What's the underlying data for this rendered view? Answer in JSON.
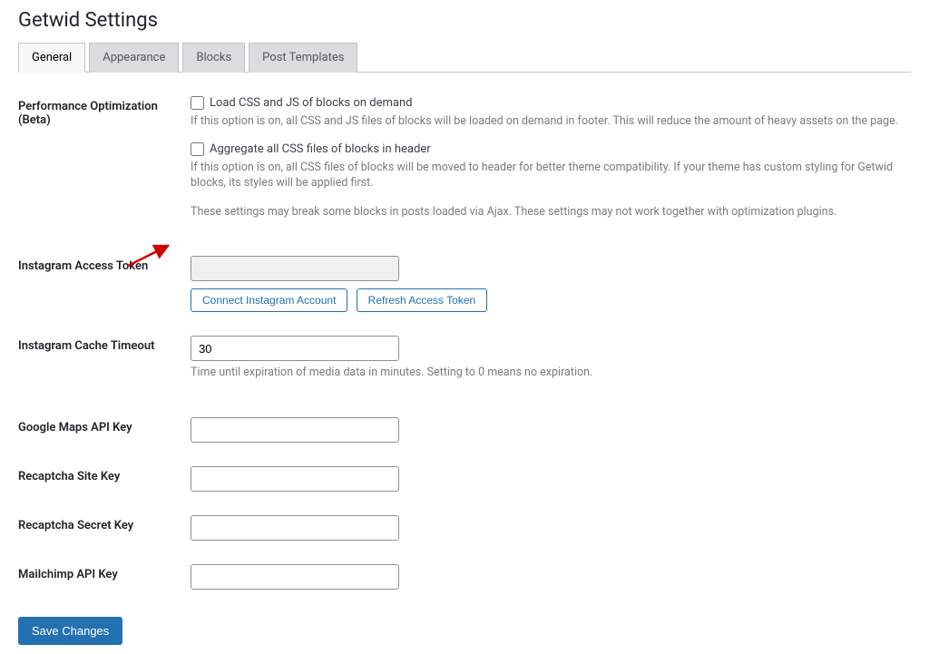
{
  "page_title": "Getwid Settings",
  "tabs": {
    "general": "General",
    "appearance": "Appearance",
    "blocks": "Blocks",
    "post_templates": "Post Templates"
  },
  "perf": {
    "label": "Performance Optimization (Beta)",
    "load_on_demand_label": "Load CSS and JS of blocks on demand",
    "load_on_demand_desc": "If this option is on, all CSS and JS files of blocks will be loaded on demand in footer. This will reduce the amount of heavy assets on the page.",
    "aggregate_label": "Aggregate all CSS files of blocks in header",
    "aggregate_desc": "If this option is on, all CSS files of blocks will be moved to header for better theme compatibility. If your theme has custom styling for Getwid blocks, its styles will be applied first.",
    "warning": "These settings may break some blocks in posts loaded via Ajax. These settings may not work together with optimization plugins."
  },
  "instagram_token": {
    "label": "Instagram Access Token",
    "value": "",
    "connect_btn": "Connect Instagram Account",
    "refresh_btn": "Refresh Access Token"
  },
  "instagram_cache": {
    "label": "Instagram Cache Timeout",
    "value": "30",
    "desc": "Time until expiration of media data in minutes. Setting to 0 means no expiration."
  },
  "gmaps": {
    "label": "Google Maps API Key",
    "value": ""
  },
  "recaptcha_site": {
    "label": "Recaptcha Site Key",
    "value": ""
  },
  "recaptcha_secret": {
    "label": "Recaptcha Secret Key",
    "value": ""
  },
  "mailchimp": {
    "label": "Mailchimp API Key",
    "value": ""
  },
  "save_btn": "Save Changes"
}
